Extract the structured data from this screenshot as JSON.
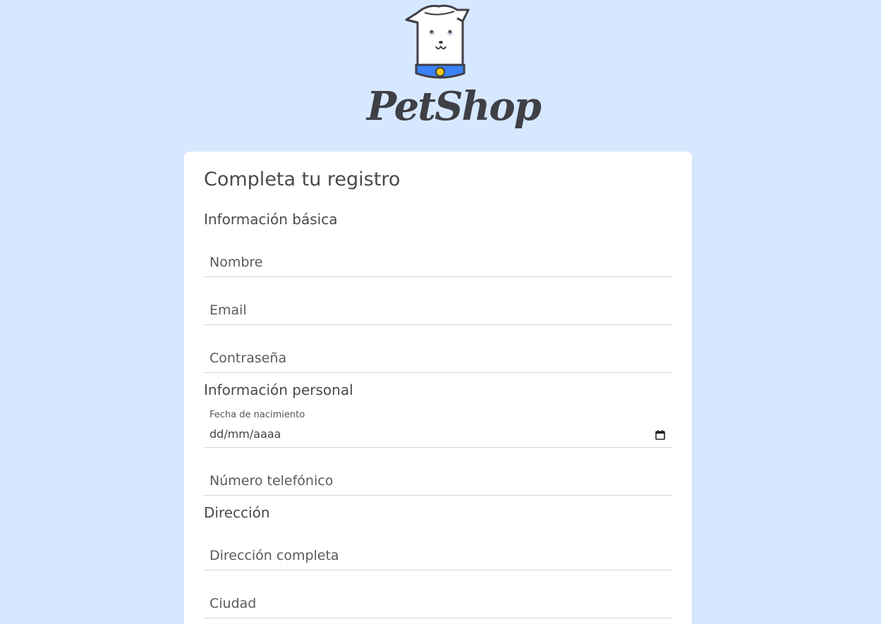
{
  "brand": {
    "name": "PetShop",
    "colors": {
      "background": "#d6e8ff",
      "collar": "#3b82f6",
      "tag": "#facc15",
      "outline": "#3f3f46"
    }
  },
  "form": {
    "title": "Completa tu registro",
    "sections": {
      "basic": {
        "title": "Información básica"
      },
      "personal": {
        "title": "Información personal"
      },
      "address": {
        "title": "Dirección"
      }
    },
    "fields": {
      "nombre": {
        "placeholder": "Nombre"
      },
      "email": {
        "placeholder": "Email"
      },
      "password": {
        "placeholder": "Contraseña"
      },
      "birthdate": {
        "label": "Fecha de nacimiento",
        "placeholder": "dd/mm/aaaa"
      },
      "phone": {
        "placeholder": "Número telefónico"
      },
      "address": {
        "placeholder": "Dirección completa"
      },
      "city": {
        "placeholder": "Ciudad"
      }
    }
  },
  "icons": {
    "logo": "dog-collar-icon",
    "calendar": "calendar-icon"
  }
}
